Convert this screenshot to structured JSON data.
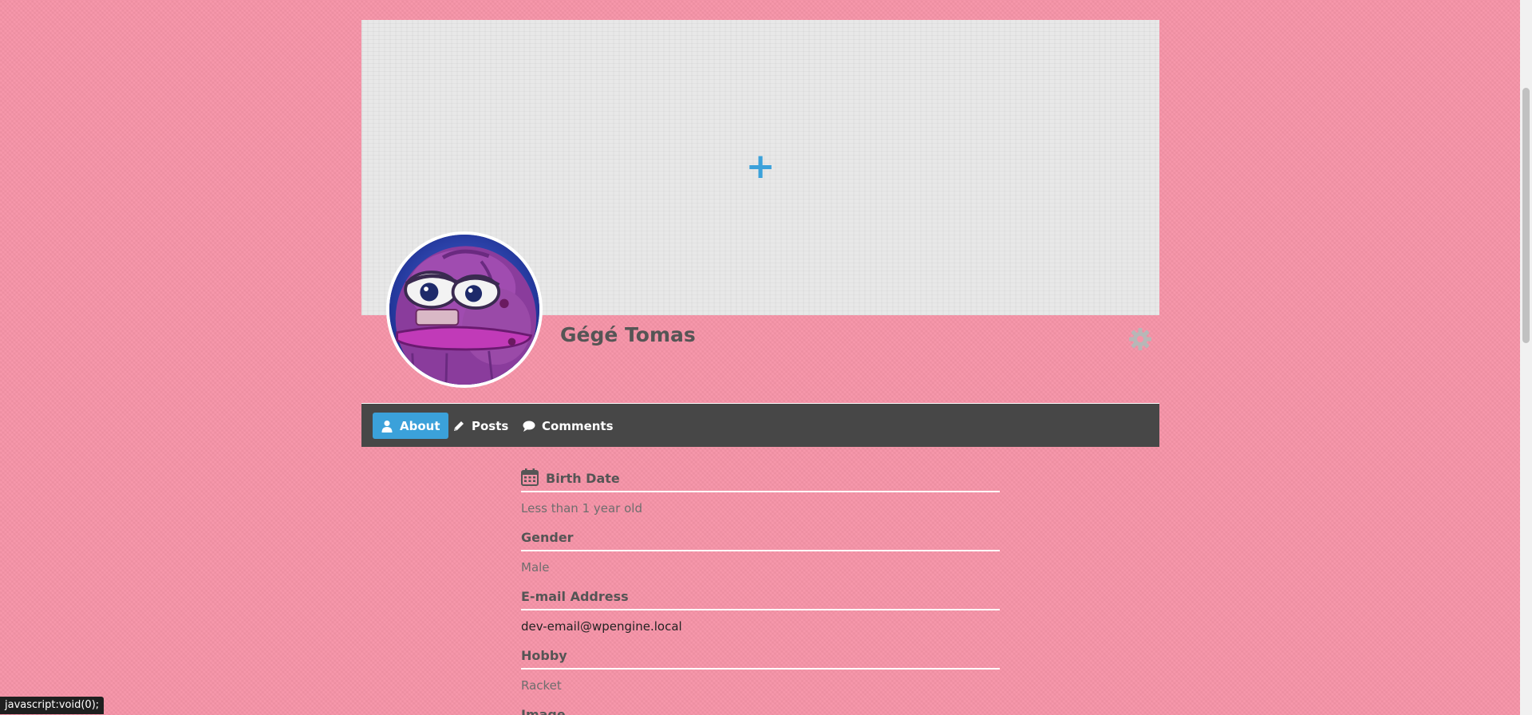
{
  "cover": {
    "add_icon": "plus-icon",
    "add_glyph": "+"
  },
  "profile": {
    "display_name": "Gégé Tomas",
    "avatar": "frog-avatar-image",
    "settings_icon": "gear-icon"
  },
  "tabs": [
    {
      "label": "About",
      "icon": "user-icon",
      "active": true
    },
    {
      "label": "Posts",
      "icon": "pencil-icon",
      "active": false
    },
    {
      "label": "Comments",
      "icon": "speech-bubble-icon",
      "active": false
    }
  ],
  "about": {
    "fields": [
      {
        "label": "Birth Date",
        "icon": "calendar-icon",
        "value": "Less than 1 year old"
      },
      {
        "label": "Gender",
        "value": "Male"
      },
      {
        "label": "E-mail Address",
        "value": "dev-email@wpengine.local"
      },
      {
        "label": "Hobby",
        "value": "Racket"
      },
      {
        "label": "Image",
        "value": ""
      }
    ]
  },
  "status_bar": {
    "text": "javascript:void(0);"
  },
  "colors": {
    "page_background": "#f794a8",
    "accent": "#3ba1da",
    "navbar": "#474747",
    "cover": "#e8e8e8"
  }
}
